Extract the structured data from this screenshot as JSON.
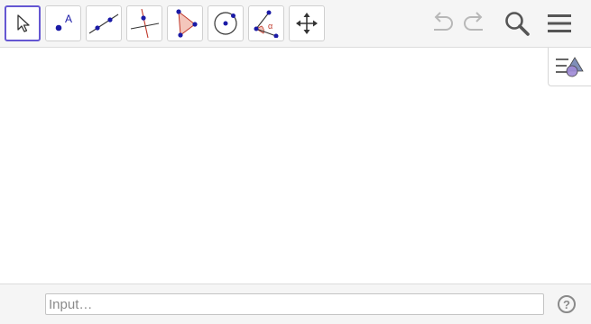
{
  "toolbar": {
    "tools": [
      {
        "name": "move",
        "icon": "cursor-arrow-icon",
        "selected": true
      },
      {
        "name": "point",
        "icon": "point-icon",
        "label": "A",
        "selected": false
      },
      {
        "name": "line",
        "icon": "line-through-two-points-icon",
        "selected": false
      },
      {
        "name": "perpendicular-line",
        "icon": "perpendicular-line-icon",
        "selected": false
      },
      {
        "name": "polygon",
        "icon": "polygon-icon",
        "selected": false
      },
      {
        "name": "circle",
        "icon": "circle-center-point-icon",
        "selected": false
      },
      {
        "name": "angle",
        "icon": "angle-icon",
        "label": "α",
        "selected": false
      },
      {
        "name": "move-graphics-view",
        "icon": "move-arrows-icon",
        "selected": false
      }
    ],
    "actions": [
      {
        "name": "undo",
        "icon": "undo-icon",
        "enabled": false
      },
      {
        "name": "redo",
        "icon": "redo-icon",
        "enabled": false
      },
      {
        "name": "search",
        "icon": "search-icon",
        "enabled": true
      },
      {
        "name": "menu",
        "icon": "hamburger-menu-icon",
        "enabled": true
      }
    ]
  },
  "style_bar": {
    "icon": "style-bar-toggle-icon"
  },
  "input_bar": {
    "placeholder": "Input…",
    "value": "",
    "help": "?"
  },
  "colors": {
    "accent": "#6557d2",
    "point": "#1a1aa6",
    "shape_fill": "#f4c6bb",
    "shape_stroke": "#c0392b",
    "icon_gray": "#555555",
    "disabled_gray": "#b8b8b8"
  }
}
